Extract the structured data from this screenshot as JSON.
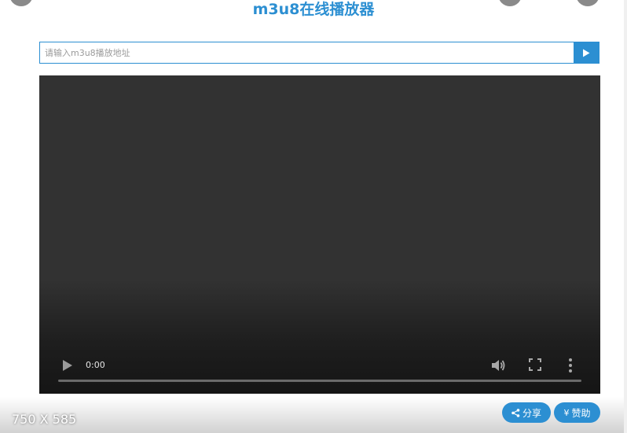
{
  "header": {
    "title": "m3u8在线播放器"
  },
  "url_bar": {
    "placeholder": "请输入m3u8播放地址",
    "value": "",
    "go_icon": "play-triangle"
  },
  "player": {
    "current_time": "0:00",
    "progress": 0,
    "icons": [
      "play-icon",
      "volume-icon",
      "fullscreen-icon",
      "more-vert-icon"
    ]
  },
  "footer": {
    "size_label": "750 X 585",
    "share_label": "分享",
    "share_icon": "share-icon",
    "donate_label": "赞助",
    "donate_symbol": "¥"
  },
  "colors": {
    "accent": "#2c8fd2",
    "video_bg": "#323232"
  }
}
